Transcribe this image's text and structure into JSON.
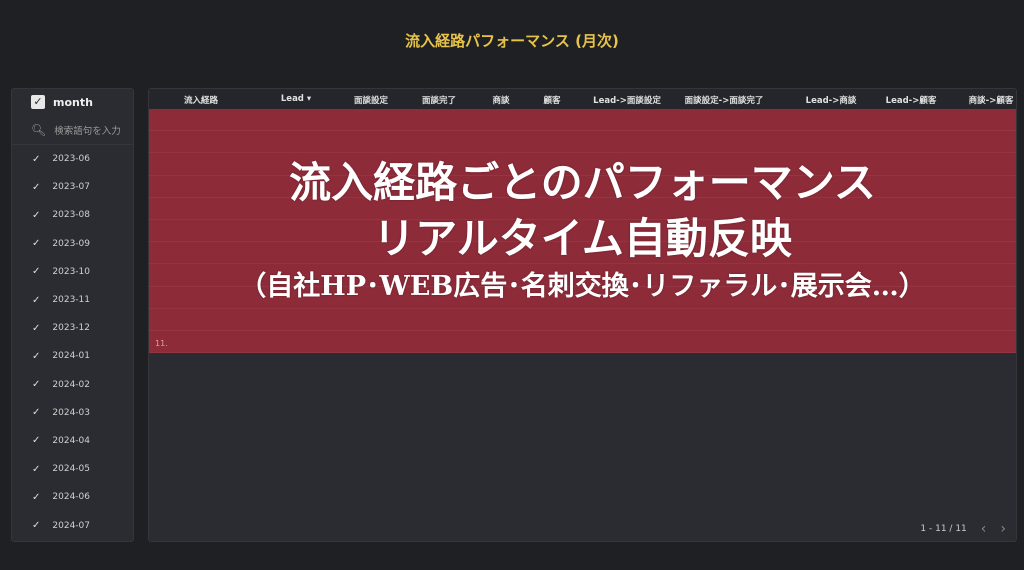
{
  "title": "流入経路パフォーマンス (月次)",
  "sidebar": {
    "header": "month",
    "search_placeholder": "検索語句を入力",
    "items": [
      "2023-06",
      "2023-07",
      "2023-08",
      "2023-09",
      "2023-10",
      "2023-11",
      "2023-12",
      "2024-01",
      "2024-02",
      "2024-03",
      "2024-04",
      "2024-05",
      "2024-06",
      "2024-07"
    ]
  },
  "table": {
    "columns": [
      "流入経路",
      "Lead ▾",
      "面談設定",
      "面談完了",
      "商談",
      "顧客",
      "Lead->面談設定",
      "面談設定->面談完了",
      "Lead->商談",
      "Lead->顧客",
      "商談->顧客"
    ],
    "row_numbers": [
      "",
      "",
      "",
      "",
      "",
      "",
      "",
      "",
      "",
      "",
      "11."
    ],
    "pagination": "1 - 11 / 11"
  },
  "banner": {
    "line1": "流入経路ごとのパフォーマンス",
    "line2": "リアルタイム自動反映",
    "line3": "（自社HP･WEB広告･名刺交換･リファラル･展示会…）"
  },
  "colors": {
    "title": "#e8c34a",
    "overlay": "#8e2b39",
    "background": "#1f2024"
  }
}
